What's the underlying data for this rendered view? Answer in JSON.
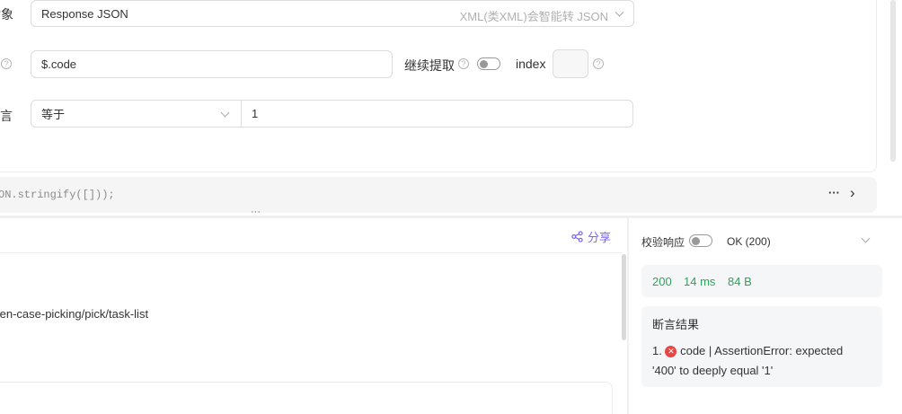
{
  "extract": {
    "target_label": "对象",
    "target_value": "Response JSON",
    "target_hint": "XML(类XML)会智能转 JSON",
    "expression_value": "$.code",
    "continue_extract_label": "继续提取",
    "index_label": "index",
    "index_value": "",
    "assert_label": "断言",
    "assert_op": "等于",
    "assert_value": "1"
  },
  "script": {
    "code": "ON.stringify([]));",
    "more_label": "···",
    "expand_label": "›",
    "resize_handle": "···"
  },
  "request": {
    "share_label": "分享",
    "path": "ten-case-picking/pick/task-list"
  },
  "response": {
    "validate_label": "校验响应",
    "status_text": "OK (200)",
    "code": "200",
    "time": "14 ms",
    "size": "84 B",
    "assert_title": "断言结果",
    "assert_index": "1.",
    "assert_error_line1": "code | AssertionError: expected",
    "assert_error_line2": "'400' to deeply equal '1'"
  },
  "colors": {
    "accent": "#7b61ff",
    "success": "#2fa35a",
    "error": "#e84545"
  }
}
